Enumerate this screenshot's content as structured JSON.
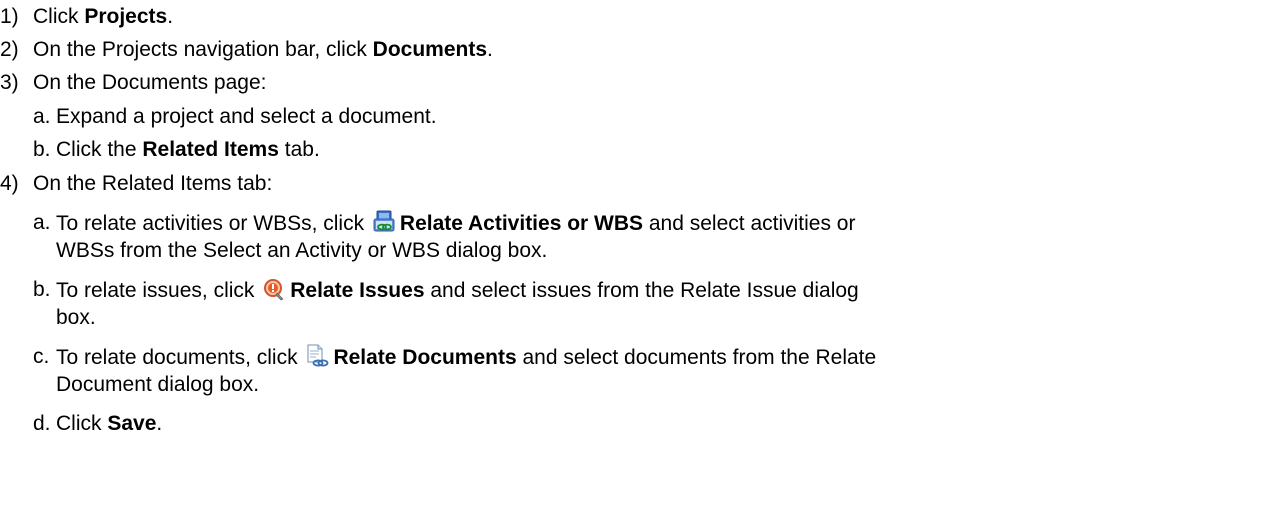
{
  "steps": [
    {
      "num": "1)",
      "pre": "Click ",
      "bold": "Projects",
      "post": "."
    },
    {
      "num": "2)",
      "pre": "On the Projects navigation bar, click ",
      "bold": "Documents",
      "post": "."
    },
    {
      "num": "3)",
      "text": "On the Documents page:",
      "substeps": [
        {
          "num": "a.",
          "text": "Expand a project and select a document."
        },
        {
          "num": "b.",
          "pre": "Click the ",
          "bold": "Related Items",
          "post": " tab."
        }
      ]
    },
    {
      "num": "4)",
      "text": "On the Related Items tab:",
      "substeps": [
        {
          "num": "a.",
          "pre": "To relate activities or WBSs, click ",
          "icon": "relate-activities-icon",
          "bold": "Relate Activities or WBS",
          "post": " and select activities or",
          "line2": "WBSs from the Select an Activity or WBS dialog box."
        },
        {
          "num": "b.",
          "pre": "To relate issues, click ",
          "icon": "relate-issues-icon",
          "bold": "Relate Issues",
          "post": " and select issues from the Relate Issue dialog",
          "line2": "box."
        },
        {
          "num": "c.",
          "pre": "To relate documents, click ",
          "icon": "relate-documents-icon",
          "bold": "Relate Documents",
          "post": " and select documents from the Relate",
          "line2": "Document dialog box."
        },
        {
          "num": "d.",
          "pre": "Click ",
          "bold": "Save",
          "post": "."
        }
      ]
    }
  ]
}
